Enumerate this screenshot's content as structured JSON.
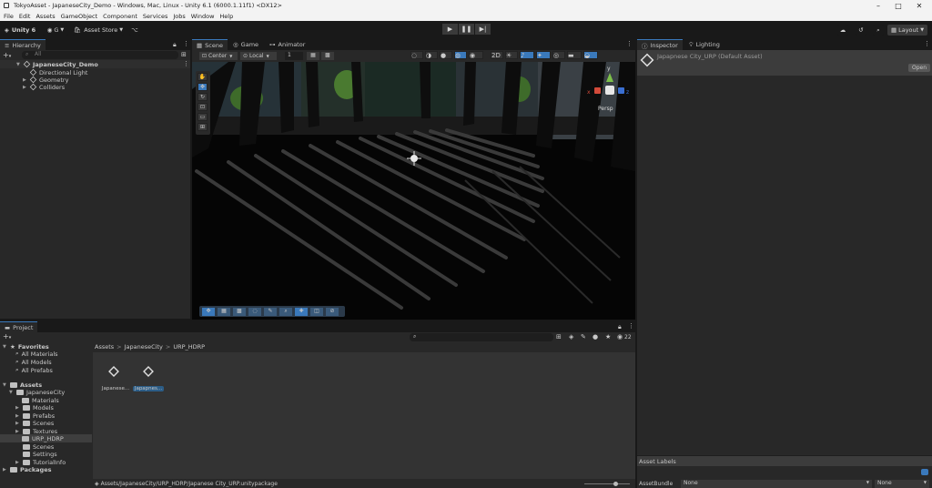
{
  "window": {
    "title": "TokyoAsset - JapaneseCity_Demo - Windows, Mac, Linux - Unity 6.1 (6000.1.11f1) <DX12>"
  },
  "menu": [
    "File",
    "Edit",
    "Assets",
    "GameObject",
    "Component",
    "Services",
    "Jobs",
    "Window",
    "Help"
  ],
  "toolbar": {
    "unity_label": "Unity 6",
    "account_label": "G",
    "asset_store": "Asset Store",
    "layout": "Layout"
  },
  "hierarchy": {
    "tab": "Hierarchy",
    "search_placeholder": "All",
    "scene": "JapaneseCity_Demo",
    "items": [
      "Directional Light",
      "Geometry",
      "Colliders"
    ]
  },
  "scene_tabs": [
    "Scene",
    "Game",
    "Animator"
  ],
  "scene_toolbar": {
    "pivot": "Center",
    "space": "Local",
    "snap": "1"
  },
  "gizmo": {
    "x": "x",
    "y": "y",
    "z": "z",
    "persp": "Persp"
  },
  "inspector": {
    "tabs": [
      "Inspector",
      "Lighting"
    ],
    "title": "Japapnese City_URP (Default Asset)",
    "open_label": "Open",
    "asset_labels": "Asset Labels",
    "assetbundle_label": "AssetBundle",
    "assetbundle_value": "None",
    "variant_value": "None"
  },
  "project": {
    "tab": "Project",
    "count": "22",
    "breadcrumb": [
      "Assets",
      "JapaneseCity",
      "URP_HDRP"
    ],
    "favorites": {
      "label": "Favorites",
      "items": [
        "All Materials",
        "All Models",
        "All Prefabs"
      ]
    },
    "assets_root": "Assets",
    "tree": [
      "JapaneseCity",
      "Materials",
      "Models",
      "Prefabs",
      "Scenes",
      "Textures",
      "URP_HDRP",
      "Scenes",
      "Settings",
      "TutorialInfo"
    ],
    "packages": "Packages",
    "files": [
      "Japanese...",
      "Japapnes..."
    ],
    "status_path": "Assets/JapaneseCity/URP_HDRP/Japanese City_URP.unitypackage"
  },
  "colors": {
    "accent": "#3a79bb",
    "panel": "#282828",
    "bg": "#191919"
  }
}
